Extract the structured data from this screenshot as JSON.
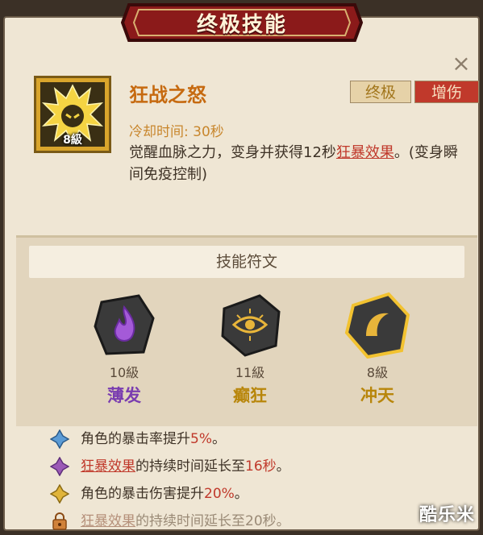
{
  "dialog": {
    "title": "终极技能",
    "close_label": "×"
  },
  "skill": {
    "name": "狂战之怒",
    "level": "8級",
    "tags": {
      "ultimate": "终极",
      "damage_boost": "增伤"
    },
    "cooldown": "冷却时间: 30秒",
    "desc_part1": "觉醒血脉之力，变身并获得12秒",
    "desc_link": "狂暴效果",
    "desc_part2": "。(变身瞬间免疫控制)"
  },
  "runes": {
    "header": "技能符文",
    "items": [
      {
        "level": "10級",
        "name": "薄发",
        "color": "#7a3db0",
        "icon": "purple-flame-icon"
      },
      {
        "level": "11級",
        "name": "癫狂",
        "color": "#b8860b",
        "icon": "eye-icon"
      },
      {
        "level": "8級",
        "name": "冲天",
        "color": "#b8860b",
        "icon": "crescent-icon"
      }
    ]
  },
  "bonuses": [
    {
      "icon": "blue-diamond-icon",
      "prefix": "角色的暴击率提升",
      "link": "",
      "highlight": "5%",
      "suffix": "。"
    },
    {
      "icon": "purple-diamond-icon",
      "prefix": "",
      "link": "狂暴效果",
      "mid": "的持续时间延长至",
      "highlight": "16秒",
      "suffix": "。"
    },
    {
      "icon": "gold-diamond-icon",
      "prefix": "角色的暴击伤害提升",
      "link": "",
      "highlight": "20%",
      "suffix": "。"
    },
    {
      "icon": "lock-icon",
      "prefix": "",
      "link": "狂暴效果",
      "mid": "的持续时间延长至",
      "highlight": "20秒",
      "suffix": "。"
    }
  ],
  "watermark": "酷乐米"
}
